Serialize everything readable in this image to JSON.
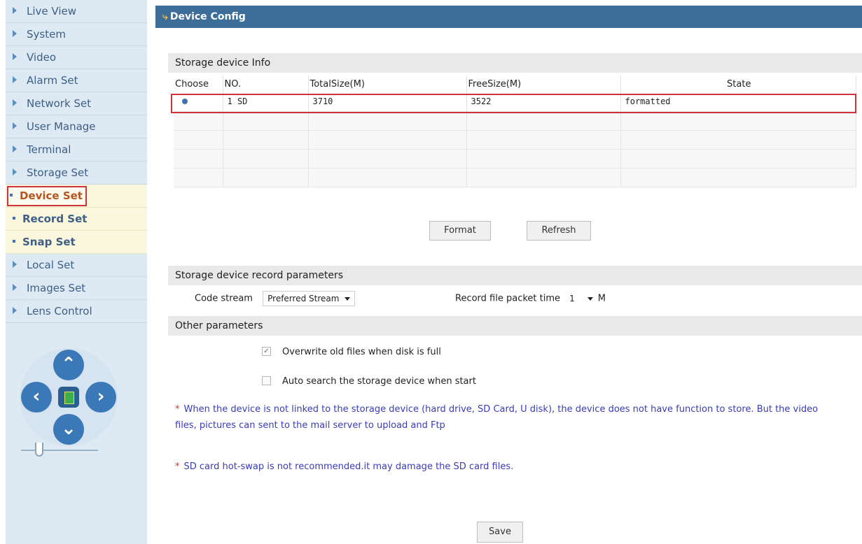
{
  "sidebar": {
    "items": [
      {
        "label": "Live View"
      },
      {
        "label": "System"
      },
      {
        "label": "Video"
      },
      {
        "label": "Alarm Set"
      },
      {
        "label": "Network Set"
      },
      {
        "label": "User Manage"
      },
      {
        "label": "Terminal"
      },
      {
        "label": "Storage Set"
      }
    ],
    "subitems": [
      {
        "label": "Device Set",
        "active": true
      },
      {
        "label": "Record Set"
      },
      {
        "label": "Snap Set"
      }
    ],
    "items_after": [
      {
        "label": "Local Set"
      },
      {
        "label": "Images Set"
      },
      {
        "label": "Lens Control"
      }
    ]
  },
  "header": {
    "title": "Device Config"
  },
  "storage_info": {
    "title": "Storage device Info",
    "columns": [
      "Choose",
      "NO.",
      "TotalSize(M)",
      "FreeSize(M)",
      "State"
    ],
    "rows": [
      {
        "no": "1  SD",
        "total": "3710",
        "free": "3522",
        "state": "formatted"
      }
    ],
    "empty_rows": 4
  },
  "buttons": {
    "format": "Format",
    "refresh": "Refresh",
    "save": "Save"
  },
  "record_params": {
    "title": "Storage device record parameters",
    "code_stream_label": "Code stream",
    "code_stream_value": "Preferred Stream",
    "packet_label": "Record file packet time",
    "packet_value": "1",
    "packet_unit": "M"
  },
  "other_params": {
    "title": "Other parameters",
    "overwrite_label": "Overwrite old files when disk is full",
    "overwrite_checked": true,
    "auto_search_label": "Auto search the storage device when start",
    "auto_search_checked": false
  },
  "notes": {
    "star": "*",
    "note1": "When the device is not linked to the storage device (hard drive, SD Card, U disk), the device does not have function to store. But the video files, pictures can sent to the mail server to upload and Ftp",
    "note2": "SD card hot-swap is not recommended.it may damage the SD card files."
  },
  "colors": {
    "header_bg": "#3d6d99",
    "highlight": "#d1313b",
    "note_text": "#3b3bb8"
  }
}
